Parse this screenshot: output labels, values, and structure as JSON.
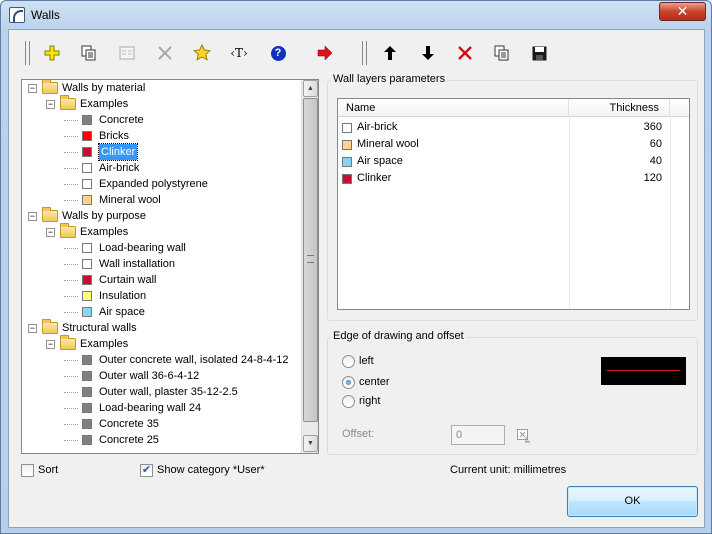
{
  "window": {
    "title": "Walls",
    "close_glyph": "✕"
  },
  "toolbar": {
    "icons": [
      "add-icon",
      "copy-icon",
      "properties-icon",
      "delete-icon",
      "favorite-star-icon",
      "text-tag-icon",
      "help-icon",
      "move-right-icon",
      "move-up-icon",
      "move-down-icon",
      "remove-layer-icon",
      "copy-layer-icon",
      "save-icon"
    ],
    "text_tag_label": "‹T›",
    "help_label": "?"
  },
  "tree": {
    "nodes": [
      {
        "label": "Walls by material",
        "kind": "folder",
        "level": 0,
        "expanded": true
      },
      {
        "label": "Examples",
        "kind": "folder",
        "level": 1,
        "expanded": true
      },
      {
        "label": "Concrete",
        "kind": "item",
        "level": 2,
        "color": "#808080"
      },
      {
        "label": "Bricks",
        "kind": "item",
        "level": 2,
        "color": "#ff0000"
      },
      {
        "label": "Clinker",
        "kind": "item",
        "level": 2,
        "color": "#c8102e",
        "selected": true
      },
      {
        "label": "Air-brick",
        "kind": "item",
        "level": 2,
        "color": "#ffffff"
      },
      {
        "label": "Expanded polystyrene",
        "kind": "item",
        "level": 2,
        "color": "#ffffff"
      },
      {
        "label": "Mineral wool",
        "kind": "item",
        "level": 2,
        "color": "#fdd584"
      },
      {
        "label": "Walls by purpose",
        "kind": "folder",
        "level": 0,
        "expanded": true
      },
      {
        "label": "Examples",
        "kind": "folder",
        "level": 1,
        "expanded": true
      },
      {
        "label": "Load-bearing wall",
        "kind": "item",
        "level": 2,
        "color": "#ffffff"
      },
      {
        "label": "Wall installation",
        "kind": "item",
        "level": 2,
        "color": "#ffffff"
      },
      {
        "label": "Curtain wall",
        "kind": "item",
        "level": 2,
        "color": "#c8102e"
      },
      {
        "label": "Insulation",
        "kind": "item",
        "level": 2,
        "color": "#ffff80"
      },
      {
        "label": "Air space",
        "kind": "item",
        "level": 2,
        "color": "#80d8f8"
      },
      {
        "label": "Structural walls",
        "kind": "folder",
        "level": 0,
        "expanded": true
      },
      {
        "label": "Examples",
        "kind": "folder",
        "level": 1,
        "expanded": true
      },
      {
        "label": "Outer concrete wall, isolated 24-8-4-12",
        "kind": "item",
        "level": 2,
        "color": "#808080"
      },
      {
        "label": "Outer wall 36-6-4-12",
        "kind": "item",
        "level": 2,
        "color": "#808080"
      },
      {
        "label": "Outer wall, plaster 35-12-2.5",
        "kind": "item",
        "level": 2,
        "color": "#808080"
      },
      {
        "label": "Load-bearing wall 24",
        "kind": "item",
        "level": 2,
        "color": "#808080"
      },
      {
        "label": "Concrete 35",
        "kind": "item",
        "level": 2,
        "color": "#808080"
      },
      {
        "label": "Concrete 25",
        "kind": "item",
        "level": 2,
        "color": "#808080"
      }
    ],
    "scroll_up_glyph": "▲",
    "scroll_down_glyph": "▼"
  },
  "layers": {
    "title": "Wall layers parameters",
    "columns": [
      "Name",
      "Thickness"
    ],
    "rows": [
      {
        "name": "Air-brick",
        "thickness": "360",
        "color": "#ffffff"
      },
      {
        "name": "Mineral wool",
        "thickness": "60",
        "color": "#fdd584"
      },
      {
        "name": "Air space",
        "thickness": "40",
        "color": "#80d8f8"
      },
      {
        "name": "Clinker",
        "thickness": "120",
        "color": "#c8102e"
      }
    ]
  },
  "edge": {
    "title": "Edge of drawing and offset",
    "options": [
      "left",
      "center",
      "right"
    ],
    "selected": "center",
    "offset_label": "Offset:",
    "offset_value": "0"
  },
  "footer": {
    "sort_label": "Sort",
    "sort_checked": false,
    "show_category_label": "Show category *User*",
    "show_category_checked": true,
    "check_glyph": "✔",
    "unit_label": "Current unit: millimetres",
    "ok_label": "OK"
  }
}
